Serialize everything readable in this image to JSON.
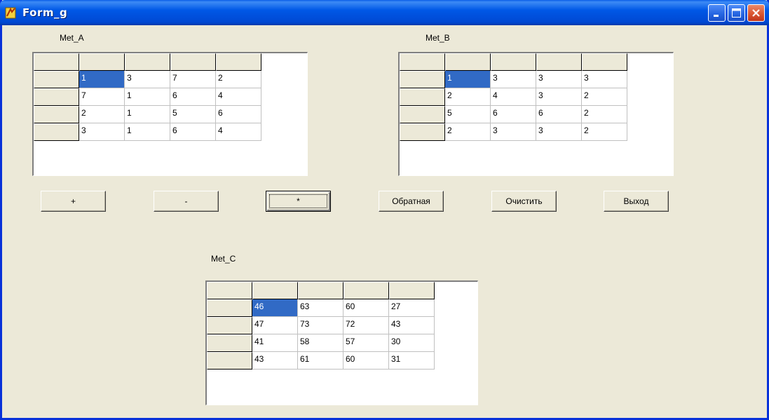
{
  "window": {
    "title": "Form_g"
  },
  "labels": {
    "a": "Met_A",
    "b": "Met_B",
    "c": "Met_C"
  },
  "matrices": {
    "a": [
      [
        "1",
        "3",
        "7",
        "2"
      ],
      [
        "7",
        "1",
        "6",
        "4"
      ],
      [
        "2",
        "1",
        "5",
        "6"
      ],
      [
        "3",
        "1",
        "6",
        "4"
      ]
    ],
    "b": [
      [
        "1",
        "3",
        "3",
        "3"
      ],
      [
        "2",
        "4",
        "3",
        "2"
      ],
      [
        "5",
        "6",
        "6",
        "2"
      ],
      [
        "2",
        "3",
        "3",
        "2"
      ]
    ],
    "c": [
      [
        "46",
        "63",
        "60",
        "27"
      ],
      [
        "47",
        "73",
        "72",
        "43"
      ],
      [
        "41",
        "58",
        "57",
        "30"
      ],
      [
        "43",
        "61",
        "60",
        "31"
      ]
    ]
  },
  "buttons": {
    "add": "+",
    "subtract": "-",
    "multiply": "*",
    "inverse": "Обратная",
    "clear": "Очистить",
    "exit": "Выход"
  },
  "colors": {
    "selection": "#316ac5",
    "form_bg": "#ece9d8",
    "titlebar": "#0058e6"
  }
}
